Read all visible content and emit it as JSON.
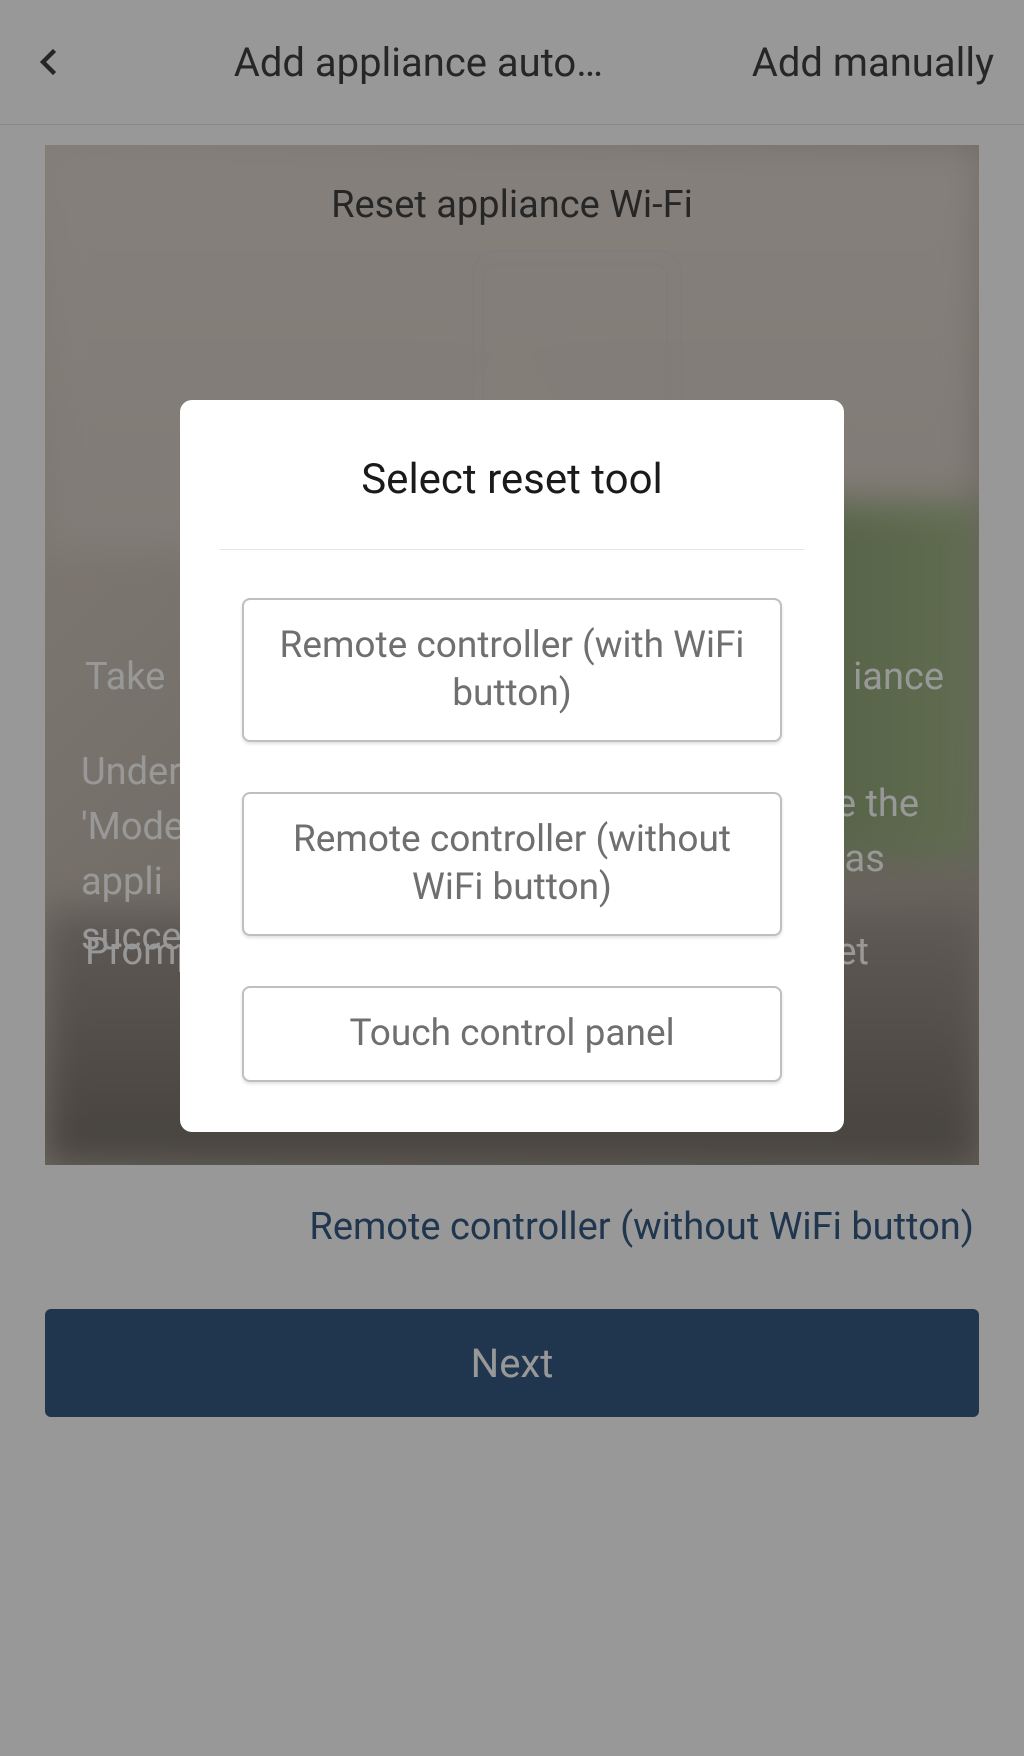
{
  "header": {
    "title": "Add appliance auto…",
    "right_action": "Add manually"
  },
  "card": {
    "title": "Reset appliance Wi-Fi",
    "text_take": "Take",
    "text_take_r": "iance",
    "text_under": "Under 'Mode appli succe",
    "text_under_r": "ce the was",
    "text_prompt": "Promp again",
    "text_prompt_r": "et"
  },
  "link": {
    "label": "Remote controller (without WiFi button)"
  },
  "next_button": {
    "label": "Next"
  },
  "modal": {
    "title": "Select reset tool",
    "options": [
      "Remote controller (with WiFi button)",
      "Remote controller (without WiFi button)",
      "Touch control panel"
    ]
  }
}
